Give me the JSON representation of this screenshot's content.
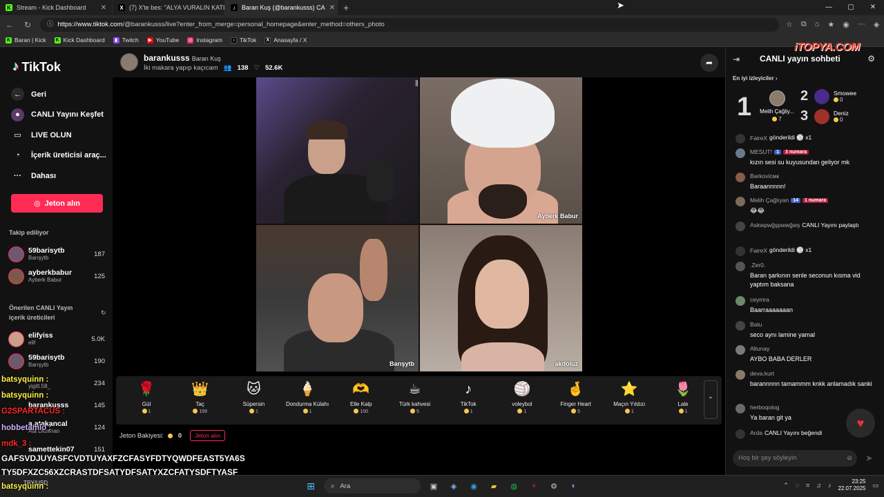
{
  "browser": {
    "tabs": [
      {
        "label": "Stream - Kick Dashboard",
        "color": "#53fc18",
        "glyph": "K"
      },
      {
        "label": "(7) X'te bes: \"ALYA VURALIN KATL",
        "color": "#000000",
        "glyph": "X"
      },
      {
        "label": "Baran Kuş (@barankusss) CA",
        "color": "#000000",
        "glyph": "♪"
      }
    ],
    "url_host": "https://www.tiktok.com",
    "url_path": "/@barankusss/live?enter_from_merge=personal_homepage&enter_method=others_photo",
    "bookmarks": [
      {
        "label": "Baran | Kick",
        "color": "#53fc18",
        "glyph": "K"
      },
      {
        "label": "Kick Dashboard",
        "color": "#53fc18",
        "glyph": "K"
      },
      {
        "label": "Twitch",
        "color": "#9146ff",
        "glyph": "▮"
      },
      {
        "label": "YouTube",
        "color": "#ff0000",
        "glyph": "▶"
      },
      {
        "label": "Instagram",
        "color": "#e1306c",
        "glyph": "◎"
      },
      {
        "label": "TikTok",
        "color": "#000000",
        "glyph": "♪"
      },
      {
        "label": "Anasayfa / X",
        "color": "#000000",
        "glyph": "X"
      }
    ]
  },
  "sidebar": {
    "logo": "TikTok",
    "nav": [
      {
        "label": "Geri",
        "icon": "arrow-left-icon",
        "glyph": "←"
      },
      {
        "label": "CANLI Yayını Keşfet",
        "icon": "live-explore-icon",
        "glyph": "●"
      },
      {
        "label": "LIVE OLUN",
        "icon": "camera-icon",
        "glyph": "▭"
      },
      {
        "label": "İçerik üreticisi araç...",
        "icon": "lightbulb-icon",
        "glyph": "◔"
      },
      {
        "label": "Dahası",
        "icon": "more-icon",
        "glyph": "···"
      }
    ],
    "jeton_button": "Jeton alın",
    "following_title": "Takip ediliyor",
    "following": [
      {
        "name": "59barisytb",
        "sub": "Barışytb",
        "count": "187"
      },
      {
        "name": "ayberkbabur",
        "sub": "Ayberk Babur",
        "count": "125"
      }
    ],
    "suggested_title": "Önerilen CANLI Yayın içerik üreticileri",
    "suggested": [
      {
        "name": "elifyiss",
        "sub": "elif",
        "count": "5.0K"
      },
      {
        "name": "59barisytb",
        "sub": "Barışytb",
        "count": "190"
      },
      {
        "name": "yigitt.58_",
        "sub": "",
        "count": "234"
      },
      {
        "name": "barankusss",
        "sub": "",
        "count": "145"
      },
      {
        "name": "a.atakancal",
        "sub": "Ata Dilzenan",
        "count": "124"
      },
      {
        "name": "samettekin07",
        "sub": "",
        "count": "151"
      }
    ]
  },
  "stream": {
    "username": "barankusss",
    "display_name": "Baran Kuş",
    "title": "İki makara yapıp kaçıcam",
    "viewers": "138",
    "likes": "52.6K",
    "cams": [
      "Ayberk Babur",
      "Barışytb",
      "akdoluz"
    ]
  },
  "gifts": [
    {
      "name": "Gül",
      "price": "1",
      "glyph": "🌹"
    },
    {
      "name": "Taç",
      "price": "199",
      "glyph": "👑"
    },
    {
      "name": "Süpersin",
      "price": "1",
      "glyph": "🐱"
    },
    {
      "name": "Dondurma Külahı",
      "price": "1",
      "glyph": "🍦"
    },
    {
      "name": "Elle Kalp",
      "price": "100",
      "glyph": "🫶"
    },
    {
      "name": "Türk kahvesi",
      "price": "5",
      "glyph": "☕"
    },
    {
      "name": "TikTok",
      "price": "1",
      "glyph": "♪"
    },
    {
      "name": "voleybol",
      "price": "1",
      "glyph": "🏐"
    },
    {
      "name": "Finger Heart",
      "price": "5",
      "glyph": "🤞"
    },
    {
      "name": "Maçın Yıldızı",
      "price": "1",
      "glyph": "⭐"
    },
    {
      "name": "Lale",
      "price": "1",
      "glyph": "🌷"
    }
  ],
  "balance": {
    "label": "Jeton Bakiyesi:",
    "value": "0",
    "button": "Jeton alın"
  },
  "chat": {
    "title": "CANLI yayın sohbeti",
    "top_viewers_label": "En iyi izleyiciler",
    "top": [
      {
        "rank": "1",
        "name": "Melih Çağliy...",
        "score": "7",
        "color": "#8c7a6a"
      },
      {
        "rank": "2",
        "name": "Smowee",
        "score": "0",
        "color": "#4a2a8a"
      },
      {
        "rank": "3",
        "name": "Deniz",
        "score": "0",
        "color": "#a0302a"
      }
    ],
    "messages": [
      {
        "user": "FaireX",
        "inline": "gönderildi 🏐 x1",
        "text": "",
        "b1": "",
        "b2": ""
      },
      {
        "user": "MESUT!",
        "inline": "",
        "text": "kızın sesi su kuyusundan geliyor mk",
        "b1": "1",
        "b2": "3 numara"
      },
      {
        "user": "Barkovicмк",
        "inline": "",
        "text": "Baraannnnn!",
        "b1": "",
        "b2": ""
      },
      {
        "user": "Melih Çağlıyan",
        "inline": "",
        "text": "😂😂",
        "b1": "14",
        "b2": "1 numara"
      },
      {
        "user": "Askwpwğşpwwğwş",
        "inline": "CANLI Yayını paylaştı",
        "text": "",
        "b1": "",
        "b2": ""
      },
      {
        "user": "FaireX",
        "inline": "gönderildi 🏐 x1",
        "text": "",
        "b1": "",
        "b2": ""
      },
      {
        "user": ".Zer0.",
        "inline": "",
        "text": "Baran şarkının senle seconun kısma vid yaptım baksana",
        "b1": "",
        "b2": ""
      },
      {
        "user": "ceymra",
        "inline": "",
        "text": "Baarraaaaaaan",
        "b1": "",
        "b2": ""
      },
      {
        "user": "Batu",
        "inline": "",
        "text": "seco aynı lamine yamal",
        "b1": "",
        "b2": ""
      },
      {
        "user": "Altunay",
        "inline": "",
        "text": "AYBO BABA DERLER",
        "b1": "",
        "b2": ""
      },
      {
        "user": "deva.kurt",
        "inline": "",
        "text": "barannnnn tamammm knkk anlamadık sanki",
        "b1": "",
        "b2": ""
      },
      {
        "user": "herboqolog",
        "inline": "",
        "text": "Ya baran git ya",
        "b1": "",
        "b2": ""
      },
      {
        "user": "Arda",
        "inline": "CANLI Yayını beğendi",
        "text": "",
        "b1": "",
        "b2": ""
      }
    ],
    "input_placeholder": "Hoş bir şey söyleyin"
  },
  "watermark": "iTOPYA.COM",
  "overlay": {
    "l1": "batsyquinn :",
    "l2": "batsyquinn :",
    "l3": "G2SPARTACUS :",
    "l4": "hobbetamlo :",
    "l5": "mdk_3 :",
    "l6": "GAFSVDJUYASFCVDTUYAXFZCFASYFDTYQWDFEAST5YA6S",
    "l7": "TY5DFXZC56XZCRASTDFSATYDFSATYXZCFATYSDFTYASF",
    "l8": "batsyquinn :"
  },
  "taskbar": {
    "weather": "TRY/USD",
    "search": "Ara",
    "time": "23:25",
    "date": "22.07.2025"
  }
}
